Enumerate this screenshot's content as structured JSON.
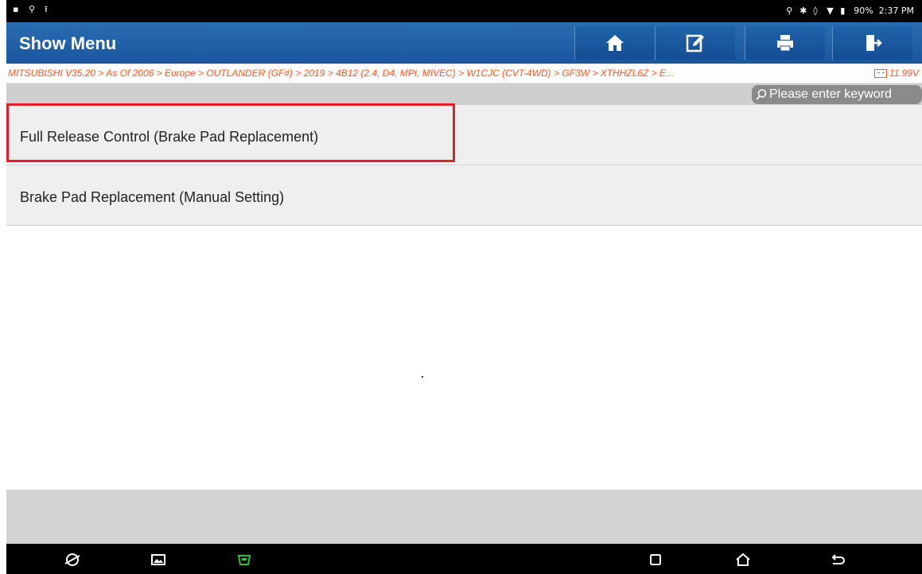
{
  "status_bar": {
    "time": "2:37 PM",
    "battery": "90%"
  },
  "header": {
    "title": "Show Menu",
    "buttons": [
      {
        "name": "home-icon"
      },
      {
        "name": "edit-icon"
      },
      {
        "name": "print-icon"
      },
      {
        "name": "exit-icon"
      }
    ]
  },
  "breadcrumb": {
    "text": "MITSUBISHI V35.20 > As Of 2006 > Europe > OUTLANDER (GF#) > 2019 > 4B12 (2.4, D4, MPI, MIVEC) > W1CJC (CVT-4WD) > GF3W > XTHHZL6Z > E...",
    "voltage": "11.99V"
  },
  "search": {
    "placeholder": "Please enter keyword"
  },
  "menu": {
    "items": [
      {
        "label": "Full Release Control (Brake Pad Replacement)"
      },
      {
        "label": "Brake Pad Replacement (Manual Setting)"
      }
    ]
  },
  "colors": {
    "header": "#1a56a0",
    "breadcrumb_text": "#ff5a1f",
    "highlight": "#e3202a"
  }
}
